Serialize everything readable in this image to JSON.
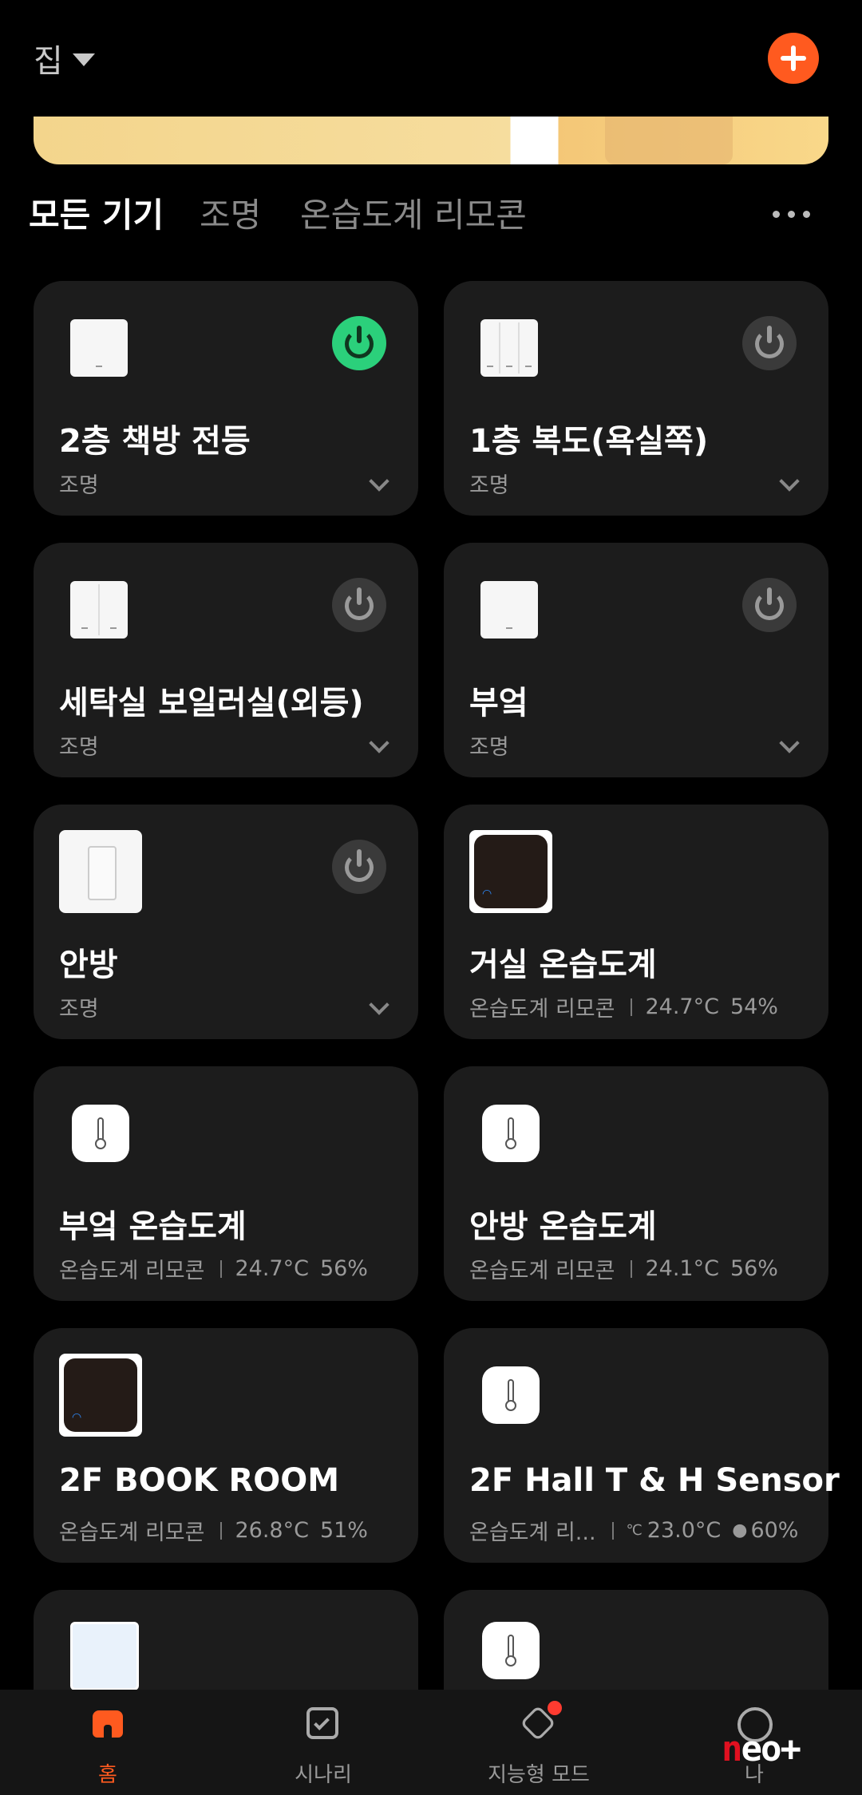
{
  "header": {
    "home_label": "집"
  },
  "tabs": [
    {
      "label": "모든 기기"
    },
    {
      "label": "조명"
    },
    {
      "label": "온습도계 리모콘"
    }
  ],
  "devices": [
    {
      "name": "2층 책방 전등",
      "category": "조명",
      "power": "on"
    },
    {
      "name": "1층 복도(욕실쪽)",
      "category": "조명",
      "power": "off"
    },
    {
      "name": "세탁실 보일러실(외등)",
      "category": "조명",
      "power": "off"
    },
    {
      "name": "부엌",
      "category": "조명",
      "power": "off"
    },
    {
      "name": "안방",
      "category": "조명",
      "power": "off"
    },
    {
      "name": "거실 온습도계",
      "category": "온습도계 리모콘",
      "temp": "24.7°C",
      "humidity": "54%"
    },
    {
      "name": "부엌 온습도계",
      "category": "온습도계 리모콘",
      "temp": "24.7°C",
      "humidity": "56%"
    },
    {
      "name": "안방 온습도계",
      "category": "온습도계 리모콘",
      "temp": "24.1°C",
      "humidity": "56%"
    },
    {
      "name": "2F BOOK ROOM",
      "category": "온습도계 리모콘",
      "temp": "26.8°C",
      "humidity": "51%"
    },
    {
      "name": "2F Hall T & H Sensor",
      "category": "온습도계 리...",
      "temp": "23.0°C",
      "humidity": "60%"
    }
  ],
  "bottom_nav": [
    {
      "label": "홈",
      "icon": "home-icon"
    },
    {
      "label": "시나리",
      "icon": "check-square-icon"
    },
    {
      "label": "지능형 모드",
      "icon": "cube-icon"
    },
    {
      "label": "나",
      "icon": "profile-icon"
    }
  ],
  "watermark": {
    "prefix": "n",
    "rest": "eo+"
  },
  "colors": {
    "accent": "#ff5a1f",
    "power_on": "#2bd07b",
    "card_bg": "#1c1c1c"
  }
}
